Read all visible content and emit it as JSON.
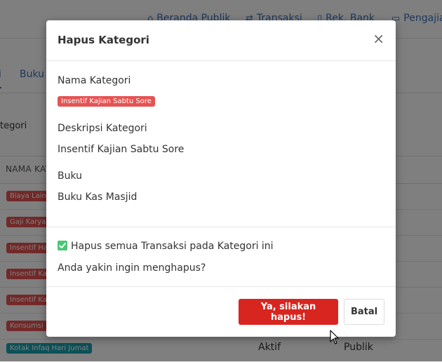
{
  "navbar": {
    "links": [
      {
        "label": "Beranda Publik",
        "icon": "home-icon"
      },
      {
        "label": "Transaksi",
        "icon": "exchange-icon"
      },
      {
        "label": "Rek. Bank",
        "icon": "bookmark-icon"
      },
      {
        "label": "Pengajian",
        "icon": "book-icon"
      }
    ]
  },
  "tabs": [
    {
      "label": "i"
    },
    {
      "label": "Buku"
    }
  ],
  "filter": {
    "label": "tegori"
  },
  "table": {
    "header": "NAMA KAT",
    "rows": [
      {
        "badge": "Biaya Lain"
      },
      {
        "badge": "Gaji Karya"
      },
      {
        "badge": "Insentif Ha"
      },
      {
        "badge": "Insentif Ka"
      },
      {
        "badge": "Insentif Ka"
      },
      {
        "badge": "Konsumsi"
      },
      {
        "badge": "Kotak Infaq Hari Jumat",
        "status": "Aktif",
        "visibility": "Publik"
      }
    ]
  },
  "modal": {
    "title": "Hapus Kategori",
    "close_symbol": "×",
    "name_label": "Nama Kategori",
    "name_badge": "Insentif Kajian Sabtu Sore",
    "description_label": "Deskripsi Kategori",
    "description_value": "Insentif Kajian Sabtu Sore",
    "book_label": "Buku",
    "book_value": "Buku Kas Masjid",
    "checkbox_label": "Hapus semua Transaksi pada Kategori ini",
    "checkbox_checked": true,
    "confirm_text": "Anda yakin ingin menghapus?",
    "confirm_button": "Ya, silakan hapus!",
    "cancel_button": "Batal"
  },
  "colors": {
    "danger": "#d9251f",
    "badge_red": "#e55353",
    "badge_teal": "#1aa3b0",
    "check_green": "#48c774",
    "link_blue": "#3b6fb6"
  }
}
